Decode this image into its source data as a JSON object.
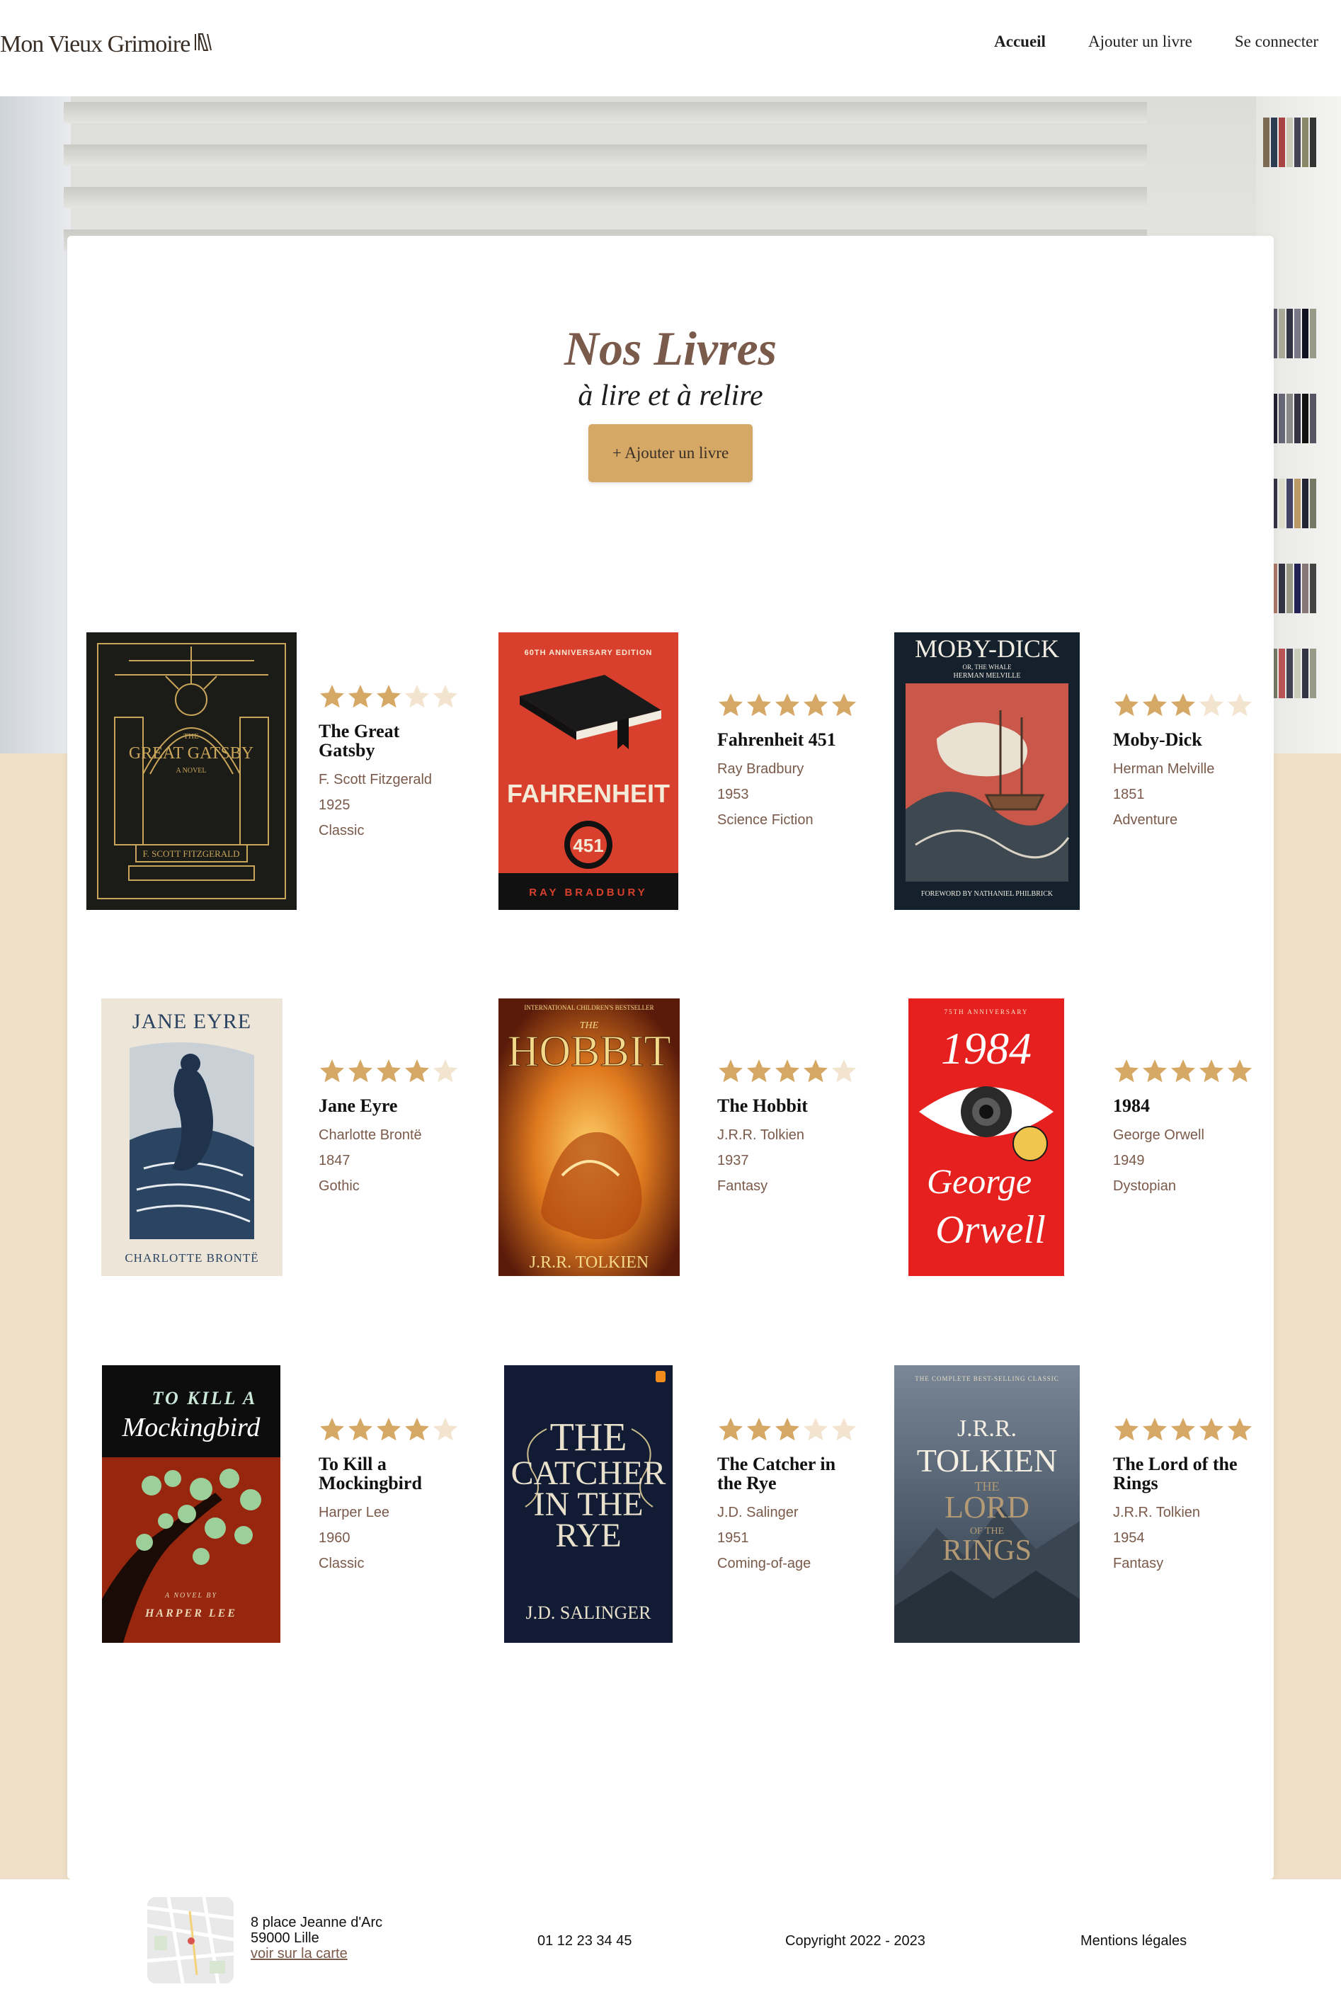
{
  "header": {
    "logo": "Mon Vieux Grimoire",
    "nav": [
      {
        "label": "Accueil"
      },
      {
        "label": "Ajouter un livre"
      },
      {
        "label": "Se connecter"
      }
    ]
  },
  "main": {
    "title": "Nos Livres",
    "subtitle": "à lire et à relire",
    "add_button": "+ Ajouter un livre"
  },
  "books": [
    {
      "title": "The Great Gatsby",
      "author": "F. Scott Fitzgerald",
      "year": "1925",
      "genre": "Classic",
      "rating": 3,
      "cover_text": [
        "THE",
        "GREAT GATSBY",
        "A NOVEL",
        "F. SCOTT FITZGERALD"
      ]
    },
    {
      "title": "Fahrenheit 451",
      "author": "Ray Bradbury",
      "year": "1953",
      "genre": "Science Fiction",
      "rating": 5,
      "cover_text": [
        "60TH ANNIVERSARY EDITION",
        "FAHRENHEIT",
        "451",
        "RAY BRADBURY"
      ]
    },
    {
      "title": "Moby-Dick",
      "author": "Herman Melville",
      "year": "1851",
      "genre": "Adventure",
      "rating": 3,
      "cover_text": [
        "MOBY-DICK",
        "OR, THE WHALE",
        "HERMAN MELVILLE",
        "FOREWORD BY NATHANIEL PHILBRICK"
      ]
    },
    {
      "title": "Jane Eyre",
      "author": "Charlotte Brontë",
      "year": "1847",
      "genre": "Gothic",
      "rating": 4,
      "cover_text": [
        "JANE EYRE",
        "CHARLOTTE BRONTË"
      ]
    },
    {
      "title": "The Hobbit",
      "author": "J.R.R. Tolkien",
      "year": "1937",
      "genre": "Fantasy",
      "rating": 4,
      "cover_text": [
        "INTERNATIONAL CHILDREN'S BESTSELLER",
        "THE",
        "HOBBIT",
        "J.R.R. TOLKIEN"
      ]
    },
    {
      "title": "1984",
      "author": "George Orwell",
      "year": "1949",
      "genre": "Dystopian",
      "rating": 5,
      "cover_text": [
        "75TH ANNIVERSARY",
        "1984",
        "George",
        "Orwell"
      ]
    },
    {
      "title": "To Kill a Mockingbird",
      "author": "Harper Lee",
      "year": "1960",
      "genre": "Classic",
      "rating": 4,
      "cover_text": [
        "TO KILL A",
        "Mockingbird",
        "A NOVEL BY",
        "HARPER LEE"
      ]
    },
    {
      "title": "The Catcher in the Rye",
      "author": "J.D. Salinger",
      "year": "1951",
      "genre": "Coming-of-age",
      "rating": 3,
      "cover_text": [
        "THE",
        "CATCHER",
        "IN THE",
        "RYE",
        "J.D. SALINGER"
      ]
    },
    {
      "title": "The Lord of the Rings",
      "author": "J.R.R. Tolkien",
      "year": "1954",
      "genre": "Fantasy",
      "rating": 5,
      "cover_text": [
        "THE COMPLETE BEST-SELLING CLASSIC",
        "J.R.R.",
        "TOLKIEN",
        "THE",
        "LORD",
        "OF THE",
        "RINGS"
      ]
    }
  ],
  "footer": {
    "address_line1": "8 place Jeanne d'Arc",
    "address_line2": "59000 Lille",
    "map_link": "voir sur la carte",
    "phone": "01 12 23 34 45",
    "copyright": "Copyright 2022 - 2023",
    "legal": "Mentions légales"
  },
  "colors": {
    "accent": "#d6a866",
    "brown": "#7a5a4b",
    "beige": "#efdfc8",
    "star_empty": "#f2e4cf"
  }
}
